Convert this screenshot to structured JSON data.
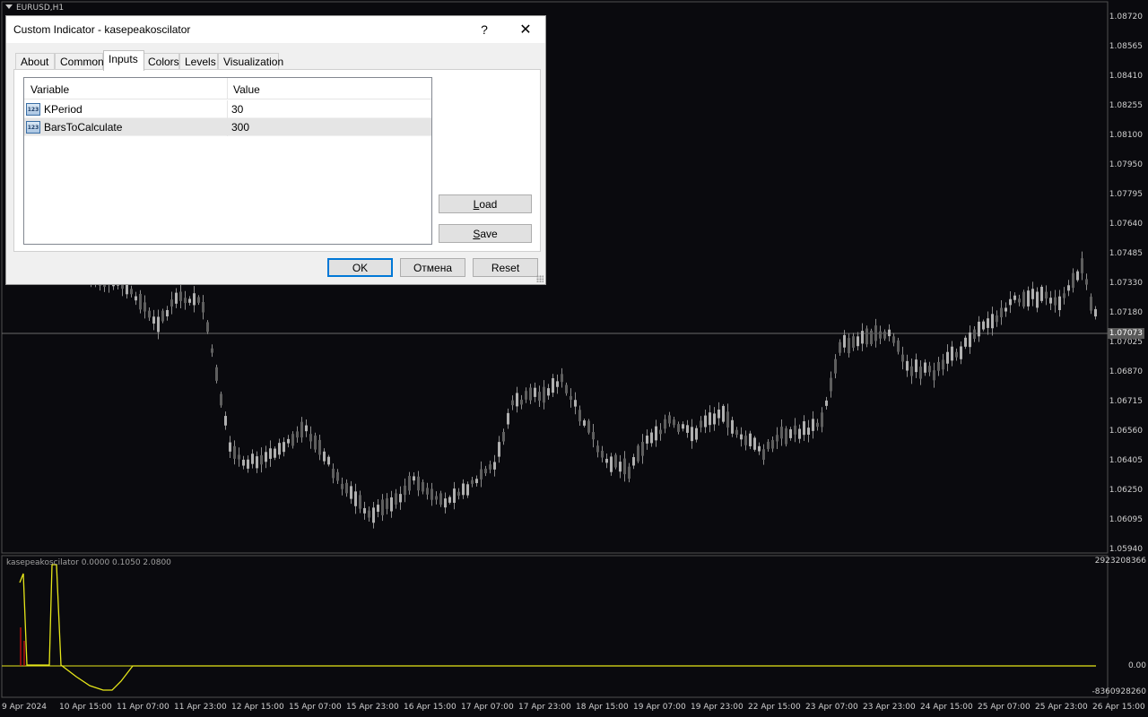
{
  "chart": {
    "symbol_label": "EURUSD,H1",
    "current_price": "1.07073",
    "price_axis": [
      "1.08720",
      "1.08565",
      "1.08410",
      "1.08255",
      "1.08100",
      "1.07950",
      "1.07795",
      "1.07640",
      "1.07485",
      "1.07330",
      "1.07180",
      "1.07025",
      "1.06870",
      "1.06715",
      "1.06560",
      "1.06405",
      "1.06250",
      "1.06095",
      "1.05940"
    ],
    "time_axis": [
      "9 Apr 2024",
      "10 Apr 15:00",
      "11 Apr 07:00",
      "11 Apr 23:00",
      "12 Apr 15:00",
      "15 Apr 07:00",
      "15 Apr 23:00",
      "16 Apr 15:00",
      "17 Apr 07:00",
      "17 Apr 23:00",
      "18 Apr 15:00",
      "19 Apr 07:00",
      "19 Apr 23:00",
      "22 Apr 15:00",
      "23 Apr 07:00",
      "23 Apr 23:00",
      "24 Apr 15:00",
      "25 Apr 07:00",
      "25 Apr 23:00",
      "26 Apr 15:00"
    ],
    "indicator_title": "kasepeakoscilator 0.0000 0.1050 2.0800",
    "indicator_axis": [
      "2923208366",
      "0.00",
      "-8360928260"
    ],
    "colors": {
      "background": "#0a0a0e",
      "candle": "#8c8c8c",
      "oscillator_line": "#e6e619",
      "oscillator_peak": "#e01010"
    }
  },
  "dialog": {
    "title": "Custom Indicator - kasepeakoscilator",
    "help_label": "?",
    "close_label": "✕",
    "tabs": [
      {
        "label": "About"
      },
      {
        "label": "Common"
      },
      {
        "label": "Inputs"
      },
      {
        "label": "Colors"
      },
      {
        "label": "Levels"
      },
      {
        "label": "Visualization"
      }
    ],
    "active_tab": "Inputs",
    "table": {
      "col_variable": "Variable",
      "col_value": "Value",
      "icon_text": "123",
      "rows": [
        {
          "name": "KPeriod",
          "value": "30"
        },
        {
          "name": "BarsToCalculate",
          "value": "300"
        }
      ]
    },
    "load_accel": "L",
    "load_rest": "oad",
    "save_accel": "S",
    "save_rest": "ave",
    "ok_label": "OK",
    "cancel_label": "Отмена",
    "reset_label": "Reset"
  }
}
